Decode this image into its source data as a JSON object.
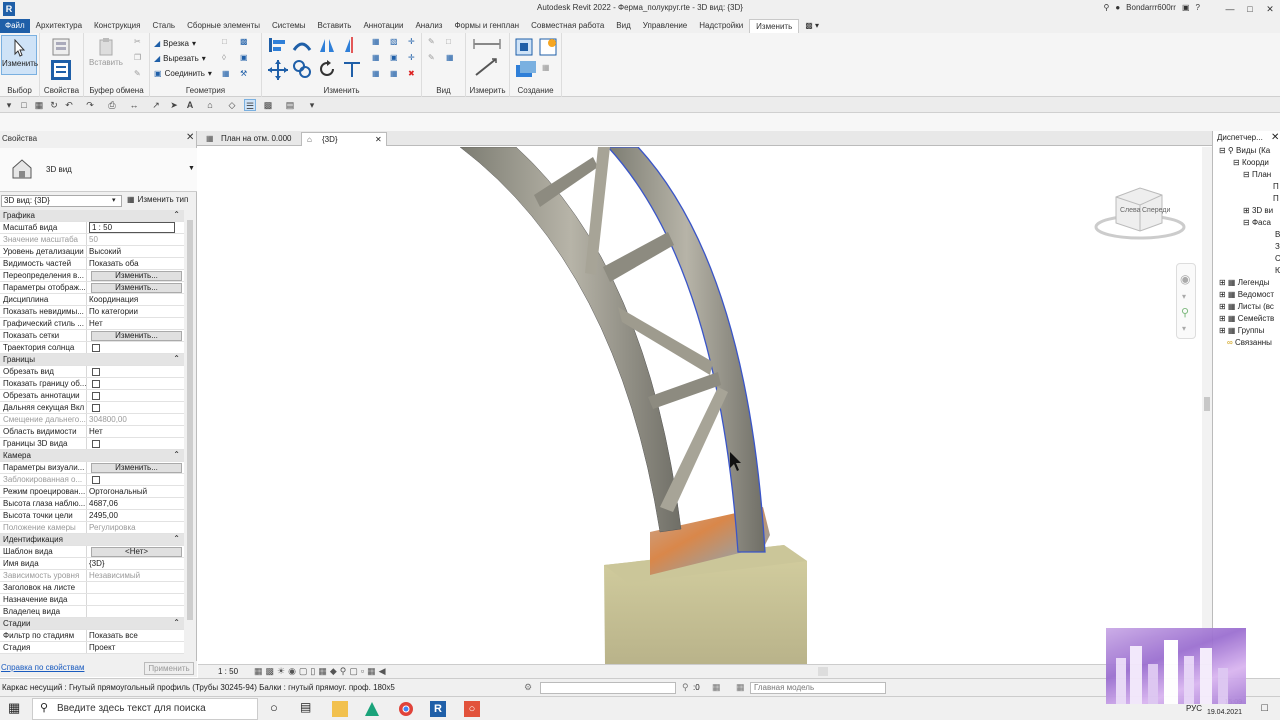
{
  "titlebar": {
    "title": "Autodesk Revit 2022 - Ферма_полукруг.rte - 3D вид: {3D}",
    "user": "Bondarrr600rr",
    "logo": "R"
  },
  "menu": [
    "Файл",
    "Архитектура",
    "Конструкция",
    "Сталь",
    "Сборные элементы",
    "Системы",
    "Вставить",
    "Аннотации",
    "Анализ",
    "Формы и генплан",
    "Совместная работа",
    "Вид",
    "Управление",
    "Надстройки",
    "Изменить"
  ],
  "ribbon": {
    "modify_label": "Изменить",
    "paste_label": "Вставить",
    "cope_label": "Врезка",
    "cut_label": "Вырезать",
    "join_label": "Соединить",
    "groups": [
      "Выбор",
      "Свойства",
      "Буфер обмена",
      "Геометрия",
      "Изменить",
      "Вид",
      "Измерить",
      "Создание"
    ]
  },
  "properties": {
    "title": "Свойства",
    "type_name": "3D вид",
    "view_selector": "3D вид: {3D}",
    "edit_type": "Изменить тип",
    "rows": [
      {
        "k": "Графика",
        "grp": true
      },
      {
        "k": "Масштаб вида",
        "v": "1 : 50",
        "input": true
      },
      {
        "k": "Значение масштаба",
        "v": "50",
        "dis": true
      },
      {
        "k": "Уровень детализации",
        "v": "Высокий"
      },
      {
        "k": "Видимость частей",
        "v": "Показать оба"
      },
      {
        "k": "Переопределения в...",
        "v": "Изменить...",
        "btn": true
      },
      {
        "k": "Параметры отображ...",
        "v": "Изменить...",
        "btn": true
      },
      {
        "k": "Дисциплина",
        "v": "Координация"
      },
      {
        "k": "Показать невидимы...",
        "v": "По категории"
      },
      {
        "k": "Графический стиль ...",
        "v": "Нет"
      },
      {
        "k": "Показать сетки",
        "v": "Изменить...",
        "btn": true
      },
      {
        "k": "Траектория солнца",
        "chk": true
      },
      {
        "k": "Границы",
        "grp": true
      },
      {
        "k": "Обрезать вид",
        "chk": true
      },
      {
        "k": "Показать границу об...",
        "chk": true
      },
      {
        "k": "Обрезать аннотации",
        "chk": true
      },
      {
        "k": "Дальняя секущая Вкл",
        "chk": true
      },
      {
        "k": "Смещение дальнего...",
        "v": "304800,00",
        "dis": true
      },
      {
        "k": "Область видимости",
        "v": "Нет"
      },
      {
        "k": "Границы 3D вида",
        "chk": true
      },
      {
        "k": "Камера",
        "grp": true
      },
      {
        "k": "Параметры визуали...",
        "v": "Изменить...",
        "btn": true
      },
      {
        "k": "Заблокированная о...",
        "chk": true,
        "dis": true
      },
      {
        "k": "Режим проецирован...",
        "v": "Ортогональный"
      },
      {
        "k": "Высота глаза наблю...",
        "v": "4687,06"
      },
      {
        "k": "Высота точки цели",
        "v": "2495,00"
      },
      {
        "k": "Положение камеры",
        "v": "Регулировка",
        "dis": true
      },
      {
        "k": "Идентификация",
        "grp": true
      },
      {
        "k": "Шаблон вида",
        "v": "<Нет>",
        "btn": true
      },
      {
        "k": "Имя вида",
        "v": "{3D}"
      },
      {
        "k": "Зависимость уровня",
        "v": "Независимый",
        "dis": true
      },
      {
        "k": "Заголовок на листе",
        "v": ""
      },
      {
        "k": "Назначение вида",
        "v": ""
      },
      {
        "k": "Владелец вида",
        "v": ""
      },
      {
        "k": "Стадии",
        "grp": true
      },
      {
        "k": "Фильтр по стадиям",
        "v": "Показать все"
      },
      {
        "k": "Стадия",
        "v": "Проект"
      }
    ],
    "help": "Справка по свойствам",
    "apply": "Применить"
  },
  "tabs": [
    {
      "label": "План на отм. 0.000"
    },
    {
      "label": "{3D}"
    }
  ],
  "viewcube": {
    "left": "Слева",
    "front": "Спереди"
  },
  "viewbar": {
    "scale": "1 : 50"
  },
  "browser": {
    "title": "Диспетчер...",
    "items": [
      "Виды (Ка",
      "Коорди",
      "План",
      "П",
      "П",
      "3D ви",
      "Фаса",
      "В",
      "З",
      "С",
      "Ю",
      "Легенды",
      "Ведомост",
      "Листы (вс",
      "Семейств",
      "Группы",
      "Связанны"
    ]
  },
  "status": {
    "text": "Каркас несущий : Гнутый прямоугольный профиль (Трубы 30245-94) Балки : гнутый прямоуг. проф. 180х5",
    "zero": ":0",
    "model": "Главная модель"
  },
  "taskbar": {
    "search": "Введите здесь текст для поиска",
    "lang": "РУС",
    "time": "15:09",
    "date": "19.04.2021"
  }
}
